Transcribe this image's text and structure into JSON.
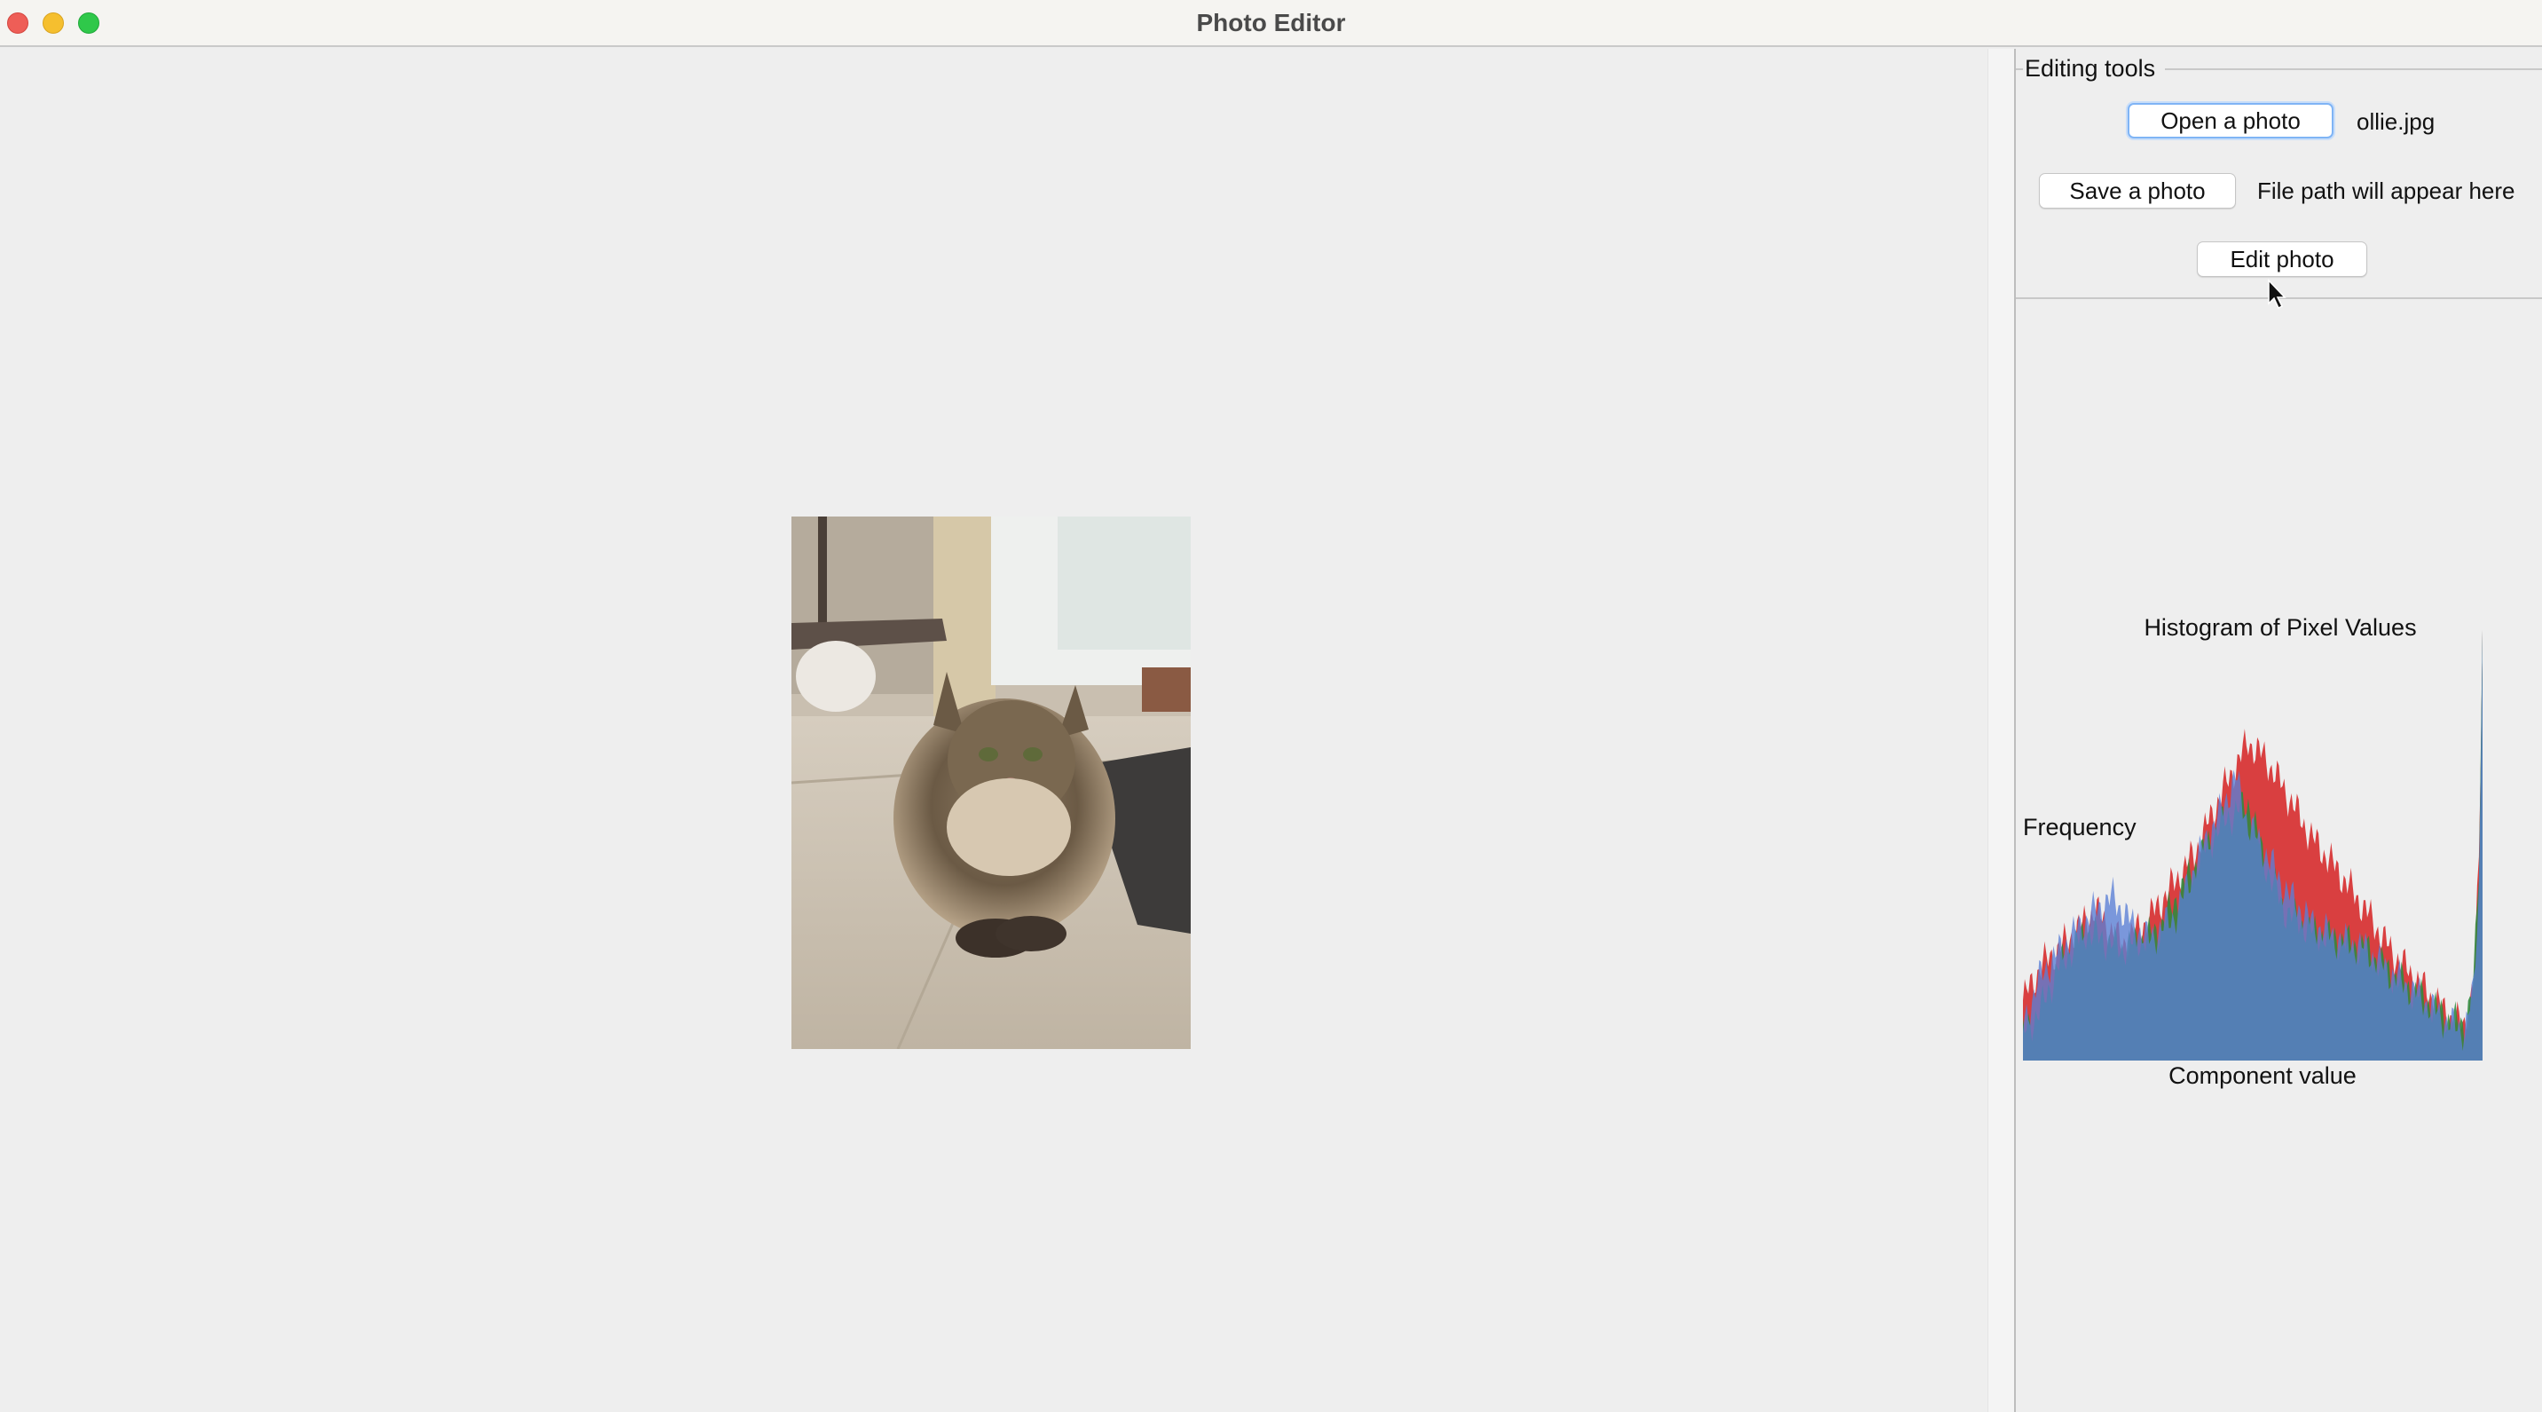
{
  "window": {
    "title": "Photo Editor"
  },
  "editing_tools": {
    "group_label": "Editing tools",
    "open_label": "Open a photo",
    "file_name": "ollie.jpg",
    "save_label": "Save a photo",
    "file_path": "File path will appear here",
    "edit_label": "Edit photo"
  },
  "histogram": {
    "title": "Histogram of Pixel Values",
    "ylabel": "Frequency",
    "xlabel": "Component value"
  },
  "chart_data": {
    "type": "area",
    "title": "Histogram of Pixel Values",
    "xlabel": "Component value",
    "ylabel": "Frequency",
    "xlim": [
      0,
      255
    ],
    "series": [
      {
        "color": "#d62728",
        "anchors": [
          [
            0,
            14
          ],
          [
            10,
            22
          ],
          [
            25,
            28
          ],
          [
            40,
            35
          ],
          [
            55,
            27
          ],
          [
            70,
            33
          ],
          [
            95,
            48
          ],
          [
            110,
            62
          ],
          [
            125,
            74
          ],
          [
            135,
            70
          ],
          [
            145,
            63
          ],
          [
            160,
            52
          ],
          [
            175,
            44
          ],
          [
            190,
            35
          ],
          [
            205,
            25
          ],
          [
            220,
            18
          ],
          [
            235,
            11
          ],
          [
            245,
            8
          ],
          [
            250,
            18
          ],
          [
            253,
            45
          ],
          [
            255,
            100
          ]
        ]
      },
      {
        "color": "#2e8b3e",
        "anchors": [
          [
            0,
            6
          ],
          [
            10,
            12
          ],
          [
            20,
            22
          ],
          [
            35,
            30
          ],
          [
            55,
            26
          ],
          [
            75,
            30
          ],
          [
            95,
            45
          ],
          [
            110,
            55
          ],
          [
            125,
            60
          ],
          [
            135,
            45
          ],
          [
            145,
            35
          ],
          [
            160,
            30
          ],
          [
            175,
            28
          ],
          [
            190,
            26
          ],
          [
            205,
            20
          ],
          [
            220,
            15
          ],
          [
            235,
            10
          ],
          [
            245,
            8
          ],
          [
            250,
            18
          ],
          [
            253,
            45
          ],
          [
            255,
            100
          ]
        ]
      },
      {
        "color": "#5a7fd6",
        "anchors": [
          [
            0,
            8
          ],
          [
            10,
            20
          ],
          [
            25,
            28
          ],
          [
            40,
            35
          ],
          [
            50,
            38
          ],
          [
            60,
            32
          ],
          [
            70,
            28
          ],
          [
            85,
            34
          ],
          [
            100,
            50
          ],
          [
            110,
            58
          ],
          [
            118,
            66
          ],
          [
            125,
            55
          ],
          [
            135,
            48
          ],
          [
            145,
            40
          ],
          [
            160,
            32
          ],
          [
            175,
            28
          ],
          [
            190,
            26
          ],
          [
            205,
            20
          ],
          [
            220,
            15
          ],
          [
            235,
            9
          ],
          [
            245,
            7
          ],
          [
            250,
            16
          ],
          [
            253,
            40
          ],
          [
            255,
            100
          ]
        ]
      }
    ]
  }
}
